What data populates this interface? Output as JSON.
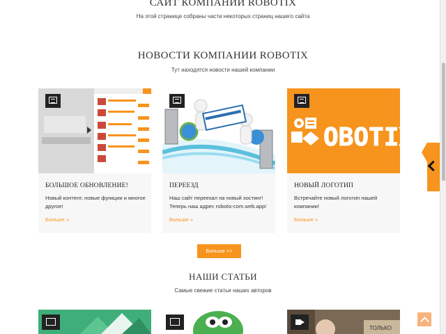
{
  "top_section": {
    "title": "Сайт компании ROBOTIX",
    "subtitle": "На этой странице собраны части некоторых страниц нашего сайта"
  },
  "news_section": {
    "title": "Новости компании ROBOTIX",
    "subtitle": "Тут находятся новости нашей компании",
    "cards": [
      {
        "badge_icon": "gallery-icon",
        "title": "Большое обновление!",
        "text": "Новый контент, новые функции и многое другое!",
        "link": "Больше »"
      },
      {
        "badge_icon": "gallery-icon",
        "title": "Переезд",
        "text": "Наш сайт переехал на новый хостинг! Теперь наш адрес robotix-com.web.app!",
        "link": "Больше »"
      },
      {
        "badge_icon": "gallery-icon",
        "title": "Новый логотип",
        "text": "Встречайте новый логотип нашей компании!",
        "link": "Больше »",
        "logo_text": "OBOTIX"
      }
    ],
    "more_button": "Больше >>"
  },
  "articles_section": {
    "title": "Наши статьи",
    "subtitle": "Самые свежие статьи наших авторов",
    "cards": [
      {
        "badge_icon": "image-icon"
      },
      {
        "badge_icon": "image-icon"
      },
      {
        "badge_icon": "video-icon",
        "overlay_text": "ТОЛЬКО"
      }
    ]
  },
  "colors": {
    "accent": "#f7941d",
    "card_bg": "#f7f7f7",
    "dark": "#222222"
  }
}
